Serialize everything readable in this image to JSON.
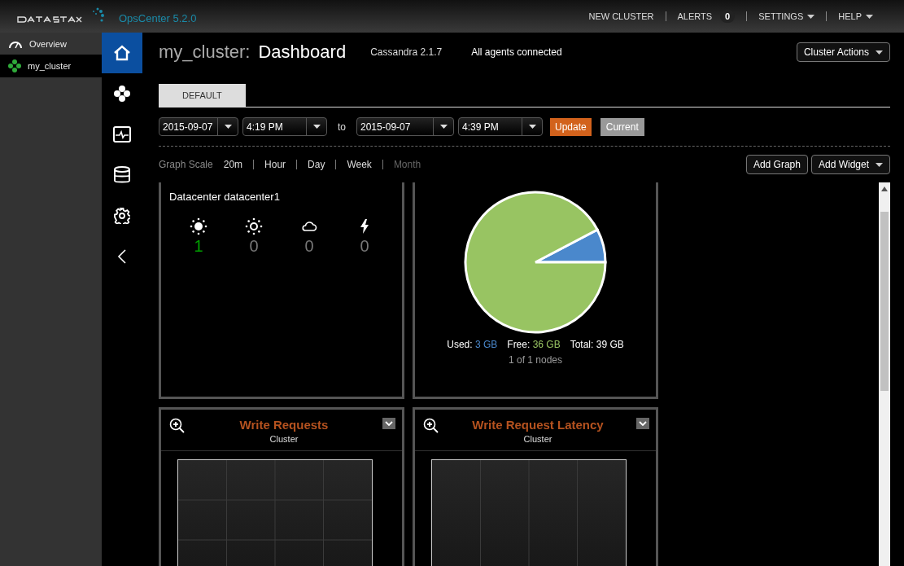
{
  "header": {
    "product": "OpsCenter 5.2.0",
    "nav": [
      {
        "label": "NEW CLUSTER",
        "kind": "link"
      },
      {
        "label": "ALERTS",
        "kind": "badge",
        "badge": "0"
      },
      {
        "label": "SETTINGS",
        "kind": "menu"
      },
      {
        "label": "HELP",
        "kind": "menu"
      }
    ]
  },
  "sidebar": {
    "items": [
      {
        "label": "Overview",
        "kind": "gauge",
        "selected": false
      },
      {
        "label": "my_cluster",
        "kind": "cluster",
        "selected": true
      }
    ]
  },
  "rail": [
    {
      "kind": "home",
      "selected": true
    },
    {
      "kind": "nodes",
      "selected": false
    },
    {
      "kind": "activity",
      "selected": false
    },
    {
      "kind": "data",
      "selected": false
    },
    {
      "kind": "settings",
      "selected": false
    },
    {
      "kind": "collapse",
      "selected": false
    }
  ],
  "page": {
    "cluster": "my_cluster:",
    "title": "Dashboard",
    "version": "Cassandra 2.1.7",
    "agents": "All agents connected",
    "actions": "Cluster Actions"
  },
  "tabs": [
    {
      "label": "DEFAULT",
      "selected": true
    }
  ],
  "range": {
    "from_date": "2015-09-07",
    "from_time": "4:19 PM",
    "to": "to",
    "to_date": "2015-09-07",
    "to_time": "4:39 PM",
    "update": "Update",
    "current": "Current"
  },
  "scale": {
    "label": "Graph Scale",
    "options": [
      {
        "label": "20m",
        "disabled": false
      },
      {
        "label": "Hour",
        "disabled": false
      },
      {
        "label": "Day",
        "disabled": false
      },
      {
        "label": "Week",
        "disabled": false
      },
      {
        "label": "Month",
        "disabled": true
      }
    ]
  },
  "buttons": {
    "add_graph": "Add Graph",
    "add_widget": "Add Widget"
  },
  "datacenter": {
    "title": "Datacenter datacenter1",
    "statuses": [
      {
        "kind": "up",
        "count": "1",
        "color": "#00a000"
      },
      {
        "kind": "sun-outline",
        "count": "0",
        "color": "#777777"
      },
      {
        "kind": "cloud",
        "count": "0",
        "color": "#777777"
      },
      {
        "kind": "bolt",
        "count": "0",
        "color": "#777777"
      }
    ]
  },
  "storage": {
    "used_label": "Used:",
    "used": "3 GB",
    "free_label": "Free:",
    "free": "36 GB",
    "total_label": "Total:",
    "total": "39 GB",
    "nodes": "1 of 1 nodes",
    "chart_data": {
      "type": "pie",
      "values": [
        7.7,
        92.3
      ]
    }
  },
  "graphs": [
    {
      "title": "Write Requests",
      "subtitle": "Cluster"
    },
    {
      "title": "Write Request Latency",
      "subtitle": "Cluster"
    }
  ]
}
